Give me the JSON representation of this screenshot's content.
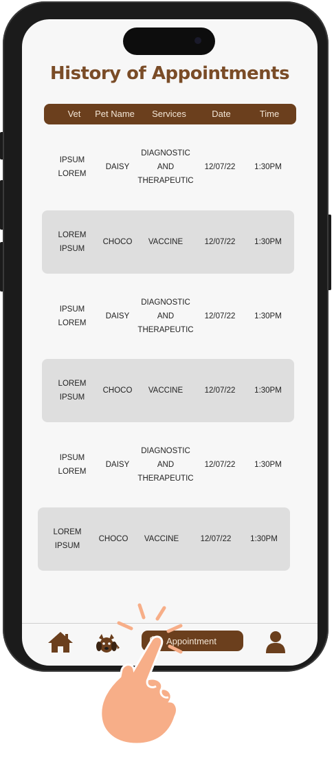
{
  "page": {
    "title": "History of Appointments"
  },
  "table": {
    "headers": [
      "Vet",
      "Pet Name",
      "Services",
      "Date",
      "Time"
    ],
    "rows": [
      {
        "vet": "IPSUM\nLOREM",
        "pet": "DAISY",
        "service": "DIAGNOSTIC\nAND\nTHERAPEUTIC",
        "date": "12/07/22",
        "time": "1:30PM"
      },
      {
        "vet": "LOREM\nIPSUM",
        "pet": "CHOCO",
        "service": "VACCINE",
        "date": "12/07/22",
        "time": "1:30PM"
      },
      {
        "vet": "IPSUM\nLOREM",
        "pet": "DAISY",
        "service": "DIAGNOSTIC\nAND\nTHERAPEUTIC",
        "date": "12/07/22",
        "time": "1:30PM"
      },
      {
        "vet": "LOREM\nIPSUM",
        "pet": "CHOCO",
        "service": "VACCINE",
        "date": "12/07/22",
        "time": "1:30PM"
      },
      {
        "vet": "IPSUM\nLOREM",
        "pet": "DAISY",
        "service": "DIAGNOSTIC\nAND\nTHERAPEUTIC",
        "date": "12/07/22",
        "time": "1:30PM"
      },
      {
        "vet": "LOREM\nIPSUM",
        "pet": "CHOCO",
        "service": "VACCINE",
        "date": "12/07/22",
        "time": "1:30PM"
      }
    ]
  },
  "nav": {
    "home_icon": "home-icon",
    "pet_icon": "dog-icon",
    "appointment_icon": "calendar-check-icon",
    "appointment_label": "Appointment",
    "profile_icon": "user-icon"
  },
  "colors": {
    "brand": "#6b3f1d",
    "title": "#7a4c27",
    "row_shade": "#dedede",
    "hand": "#f7ae88"
  }
}
